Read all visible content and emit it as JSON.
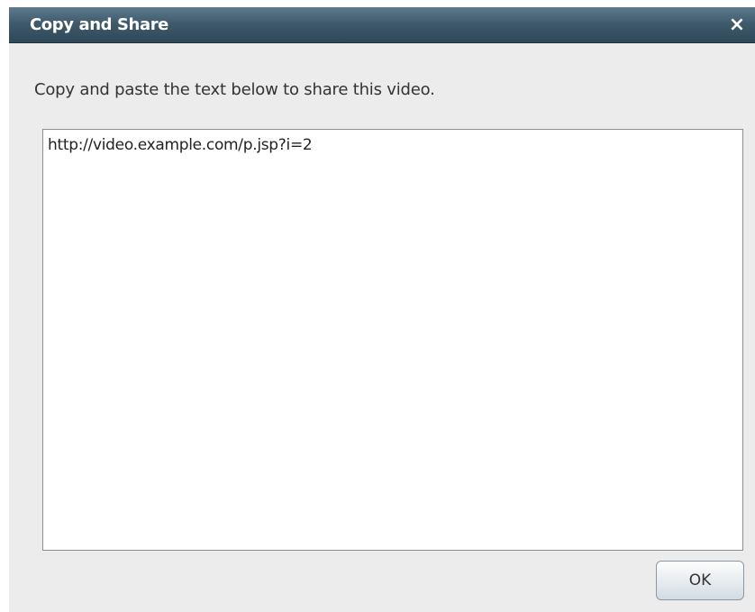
{
  "dialog": {
    "title": "Copy and Share",
    "close_glyph": "×",
    "close_icon": "close-icon",
    "instruction": "Copy and paste the text below to share this video.",
    "share_text": "http://video.example.com/p.jsp?i=2",
    "ok_label": "OK"
  },
  "colors": {
    "titlebar": "#3f5a6c",
    "background": "#ececec",
    "textarea_bg": "#ffffff"
  }
}
